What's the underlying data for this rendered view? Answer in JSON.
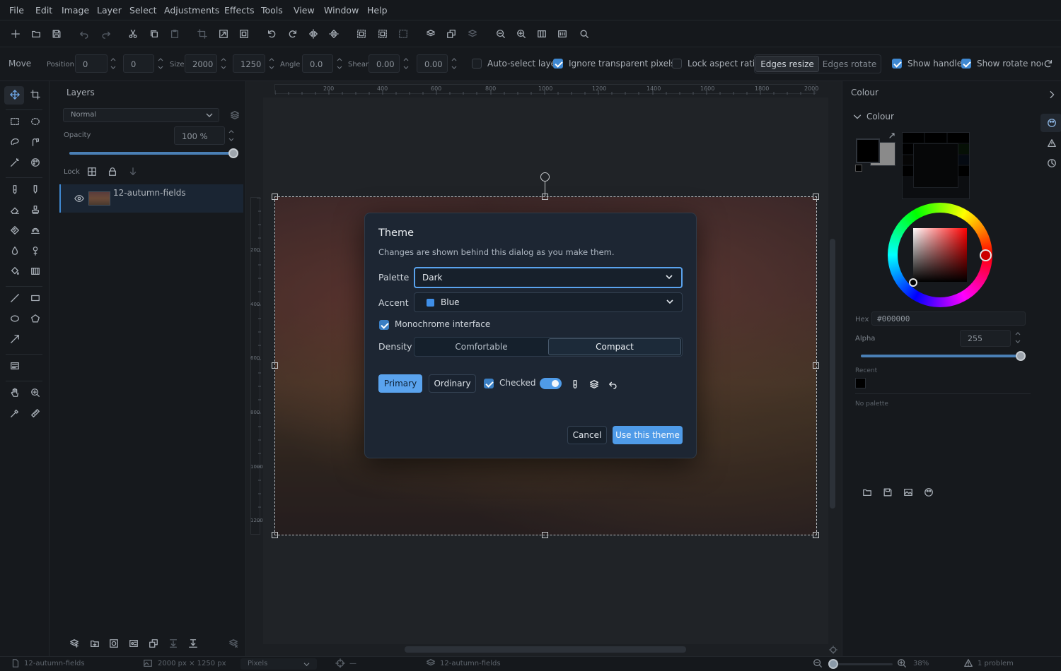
{
  "menu": [
    "File",
    "Edit",
    "Image",
    "Layer",
    "Select",
    "Adjustments",
    "Effects",
    "Tools",
    "View",
    "Window",
    "Help"
  ],
  "options": {
    "tool_name": "Move",
    "position_label": "Position",
    "position_x": "0",
    "position_y": "0",
    "size_label": "Size",
    "size_w": "2000",
    "size_h": "1250",
    "angle_label": "Angle",
    "angle": "0.0",
    "shear_label": "Shear",
    "shear_x": "0.00",
    "shear_y": "0.00",
    "auto_select": {
      "label": "Auto-select layer",
      "checked": false
    },
    "ignore_transparent": {
      "label": "Ignore transparent pixels",
      "checked": true
    },
    "lock_aspect": {
      "label": "Lock aspect ratio",
      "checked": false
    },
    "edges_resize": "Edges resize",
    "edges_rotate": "Edges rotate",
    "show_handles": {
      "label": "Show handles",
      "checked": true
    },
    "show_rotate_node": {
      "label": "Show rotate node",
      "checked": true
    }
  },
  "layers": {
    "title": "Layers",
    "blend_mode": "Normal",
    "opacity_label": "Opacity",
    "opacity_value": "100 %",
    "opacity_fraction": 1.0,
    "lock_label": "Lock",
    "items": [
      {
        "name": "12-autumn-fields",
        "visible": true
      }
    ]
  },
  "ruler": {
    "top_ticks": [
      "200",
      "400",
      "600",
      "800",
      "1000",
      "1200",
      "1400",
      "1600",
      "1800",
      "2000"
    ],
    "left_ticks": [
      "200",
      "400",
      "600",
      "800",
      "1000",
      "1200"
    ]
  },
  "colour_panel": {
    "header": "Colour",
    "section": "Colour",
    "hex_label": "Hex",
    "hex_value": "#000000",
    "alpha_label": "Alpha",
    "alpha_value": "255",
    "alpha_fraction": 1.0,
    "recent_label": "Recent",
    "no_palette": "No palette",
    "primary_color": "#000000",
    "secondary_color": "#8a8a8a"
  },
  "dialog": {
    "title": "Theme",
    "subtitle": "Changes are shown behind this dialog as you make them.",
    "palette_label": "Palette",
    "palette_value": "Dark",
    "accent_label": "Accent",
    "accent_value": "Blue",
    "accent_color": "#3f8fe8",
    "monochrome": {
      "label": "Monochrome interface",
      "checked": true
    },
    "density_label": "Density",
    "density_options": [
      "Comfortable",
      "Compact"
    ],
    "density_selected": "Compact",
    "preview": {
      "primary_button": "Primary",
      "ordinary_button": "Ordinary",
      "checked_label": "Checked",
      "toggle_on": true
    },
    "cancel": "Cancel",
    "confirm": "Use this theme"
  },
  "status": {
    "document": "12-autumn-fields",
    "dimensions": "2000 px × 1250 px",
    "units": "Pixels",
    "cursor": "—",
    "layer": "12-autumn-fields",
    "zoom": "38%",
    "problems": "1 problem"
  }
}
